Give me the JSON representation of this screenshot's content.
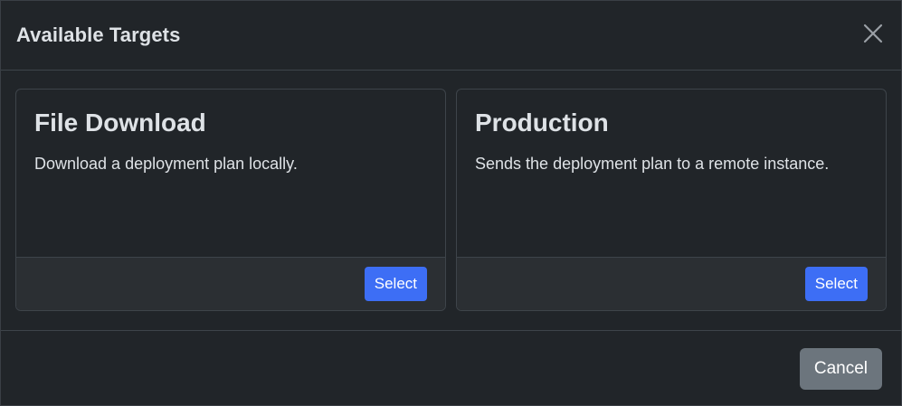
{
  "modal": {
    "title": "Available Targets",
    "close_icon": "close-icon"
  },
  "targets": [
    {
      "title": "File Download",
      "description": "Download a deployment plan locally.",
      "select_label": "Select"
    },
    {
      "title": "Production",
      "description": "Sends the deployment plan to a remote instance.",
      "select_label": "Select"
    }
  ],
  "footer": {
    "cancel_label": "Cancel"
  },
  "colors": {
    "background": "#212529",
    "border": "#3e444a",
    "card_footer": "#2b2f33",
    "primary": "#3d6ef5",
    "secondary": "#6c757d",
    "text": "#dee2e6"
  }
}
